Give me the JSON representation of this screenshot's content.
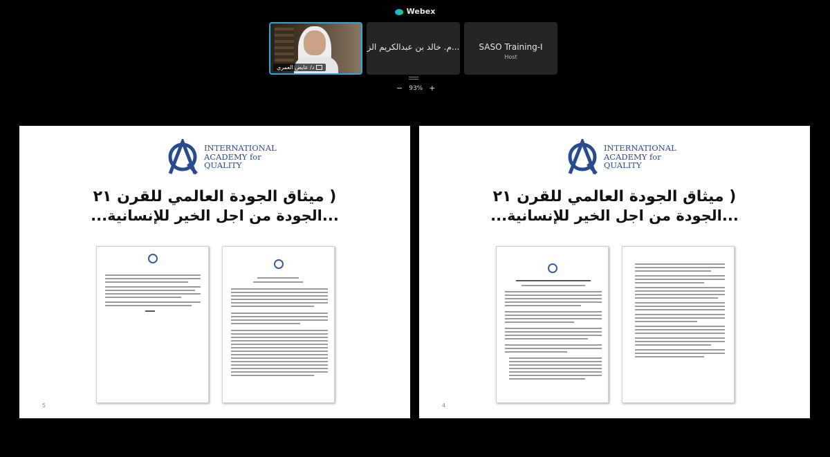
{
  "app": {
    "title": "Webex"
  },
  "participants": [
    {
      "name": "د/ عايض العمري",
      "role": "",
      "has_video": true
    },
    {
      "name": "م. خالد بن عبدالكريم الز...",
      "role": ""
    },
    {
      "name": "SASO Training-I",
      "role": "Host"
    }
  ],
  "zoom": {
    "minus": "−",
    "level": "93%",
    "plus": "+"
  },
  "slides": [
    {
      "logo_text": [
        "INTERNATIONAL",
        "ACADEMY for",
        "QUALITY"
      ],
      "title_line1": "( ميثاق الجودة العالمي للقرن ٢١",
      "title_line2": "...الجودة من اجل الخير للإنسانية...",
      "page_number": "5"
    },
    {
      "logo_text": [
        "INTERNATIONAL",
        "ACADEMY for",
        "QUALITY"
      ],
      "title_line1": "( ميثاق الجودة العالمي للقرن ٢١",
      "title_line2": "...الجودة من اجل الخير للإنسانية...",
      "page_number": "4"
    }
  ],
  "colors": {
    "accent": "#29a8e0",
    "logo_blue": "#2a4a8e"
  }
}
